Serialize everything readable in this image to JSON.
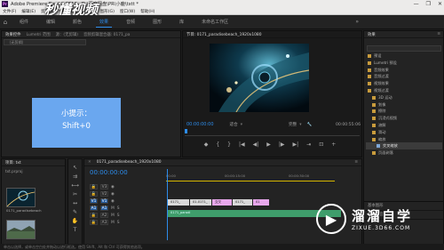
{
  "window": {
    "title": "Adobe Premiere Pro CC 2018 - D:\\百度网盘\\PR\\小鹿\\txtt *",
    "controls": [
      "—",
      "❐",
      "✕"
    ]
  },
  "menu": [
    "文件(F)",
    "编辑(E)",
    "剪辑(C)",
    "序列(S)",
    "标记(M)",
    "图形(G)",
    "窗口(W)",
    "帮助(H)"
  ],
  "overlay_logo": "秒懂视频",
  "workspace": {
    "tabs": [
      "组件",
      "编辑",
      "颜色",
      "效果",
      "音频",
      "图形",
      "库",
      "未命名工作区"
    ],
    "active": 3,
    "more": "»"
  },
  "source": {
    "tabs": [
      "效果控件",
      "Lumetri 范围",
      "源：(无剪辑)",
      "音频剪辑混合器: 0171_pa"
    ],
    "select": "（无剪辑）"
  },
  "tip": {
    "title": "小提示：",
    "keys": "Shift+0"
  },
  "program": {
    "tab": "节目: 0171_paradisebeach_1920x1080",
    "tc_left": "00:00:00:00",
    "fit": "适合",
    "quality": "完整",
    "tc_right": "00:00:55:06"
  },
  "transport": [
    "◆",
    "{",
    "}",
    "|◀",
    "◀|",
    "▶",
    "|▶",
    "▶|",
    "⇥",
    "⊡",
    "+"
  ],
  "effects": {
    "title": "效果",
    "items": [
      {
        "label": "预设",
        "type": "folder",
        "d": 0
      },
      {
        "label": "Lumetri 预设",
        "type": "folder",
        "d": 0
      },
      {
        "label": "音频效果",
        "type": "folder",
        "d": 0
      },
      {
        "label": "音频过渡",
        "type": "folder",
        "d": 0
      },
      {
        "label": "视频效果",
        "type": "folder",
        "d": 0
      },
      {
        "label": "视频过渡",
        "type": "folder",
        "d": 0
      },
      {
        "label": "3D 运动",
        "type": "folder",
        "d": 1
      },
      {
        "label": "划像",
        "type": "folder",
        "d": 1
      },
      {
        "label": "擦除",
        "type": "folder",
        "d": 1
      },
      {
        "label": "沉浸式视频",
        "type": "folder",
        "d": 1
      },
      {
        "label": "溶解",
        "type": "folder",
        "d": 1
      },
      {
        "label": "滑动",
        "type": "folder",
        "d": 1
      },
      {
        "label": "缩放",
        "type": "folder",
        "d": 1
      },
      {
        "label": "交叉缩放",
        "type": "item",
        "d": 2,
        "sel": true
      },
      {
        "label": "页面剥落",
        "type": "folder",
        "d": 1
      }
    ],
    "lower": [
      "基本图形",
      "基本声音"
    ]
  },
  "project": {
    "tab": "项目: txt",
    "file": "txt.prproj",
    "clips": [
      "0171_paradisebeach",
      "0171_beach"
    ]
  },
  "timeline": {
    "tab": "0171_paradisebeach_1920x1080",
    "tc": "00:00:00:00",
    "ruler": [
      "00:00",
      "00:00:15:00",
      "00:00:30:00"
    ],
    "tracks": [
      "V3",
      "V2",
      "V1",
      "A1",
      "A2",
      "A3"
    ],
    "clips": [
      "0171_",
      "01.0171_",
      "交叉",
      "0171_",
      "01",
      "0171_paradi"
    ]
  },
  "status": "单击以选择，或单击空白处并拖动以进行框选。使用 Shift、Alt 和 Ctrl 可获得其他选项。",
  "watermark": {
    "line1": "溜溜自学",
    "line2": "ZIXUE.3D66.COM"
  }
}
